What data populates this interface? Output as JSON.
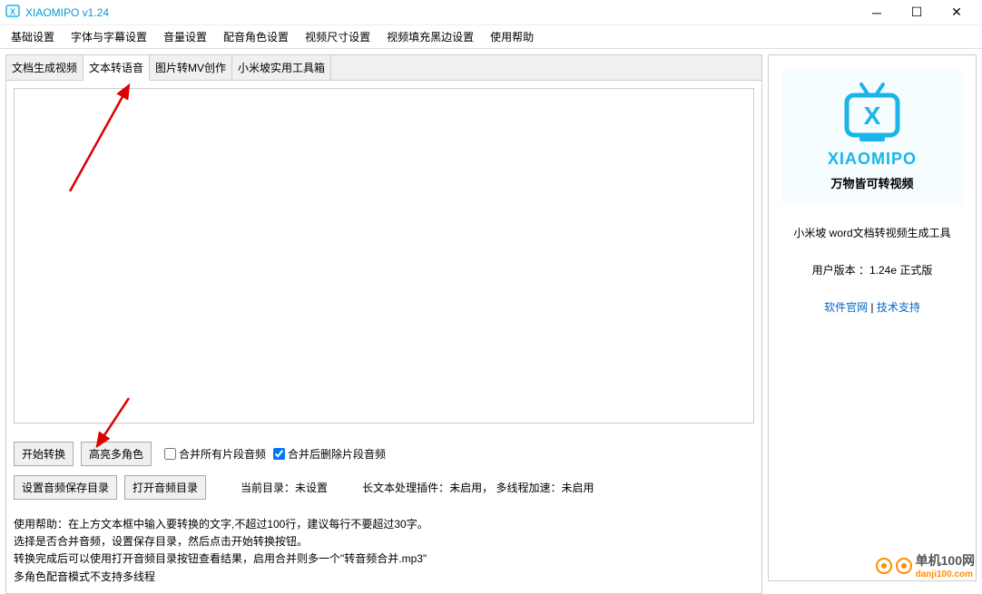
{
  "window": {
    "title": "XIAOMIPO v1.24"
  },
  "menubar": {
    "items": [
      "基础设置",
      "字体与字幕设置",
      "音量设置",
      "配音角色设置",
      "视频尺寸设置",
      "视频填充黑边设置",
      "使用帮助"
    ]
  },
  "tabs": {
    "items": [
      "文档生成视频",
      "文本转语音",
      "图片转MV创作",
      "小米坡实用工具箱"
    ],
    "active_index": 1
  },
  "textarea": {
    "value": ""
  },
  "buttons": {
    "start_convert": "开始转换",
    "highlight_roles": "高亮多角色",
    "set_audio_dir": "设置音频保存目录",
    "open_audio_dir": "打开音频目录"
  },
  "checkboxes": {
    "merge_all": {
      "label": "合并所有片段音频",
      "checked": false
    },
    "delete_after_merge": {
      "label": "合并后删除片段音频",
      "checked": true
    }
  },
  "status": {
    "current_dir_label": "当前目录：",
    "current_dir_value": "未设置",
    "plugin_label": "长文本处理插件：",
    "plugin_value": "未启用，",
    "multithread_label": "多线程加速：",
    "multithread_value": "未启用"
  },
  "help": {
    "line1": "使用帮助：在上方文本框中输入要转换的文字,不超过100行，建议每行不要超过30字。",
    "line2": "选择是否合并音频，设置保存目录，然后点击开始转换按钮。",
    "line3": "转换完成后可以使用打开音频目录按钮查看结果，启用合并则多一个\"转音频合并.mp3\"",
    "line4": "多角色配音模式不支持多线程"
  },
  "sidebar": {
    "brand": "XIAOMIPO",
    "tagline": "万物皆可转视频",
    "description": "小米坡 word文档转视频生成工具",
    "version_label": "用户版本 ：",
    "version_value": "1.24e 正式版",
    "link1": "软件官网",
    "link_sep": " | ",
    "link2": "技术支持"
  },
  "watermark": {
    "top": "单机100网",
    "bottom": "danji100.com"
  }
}
